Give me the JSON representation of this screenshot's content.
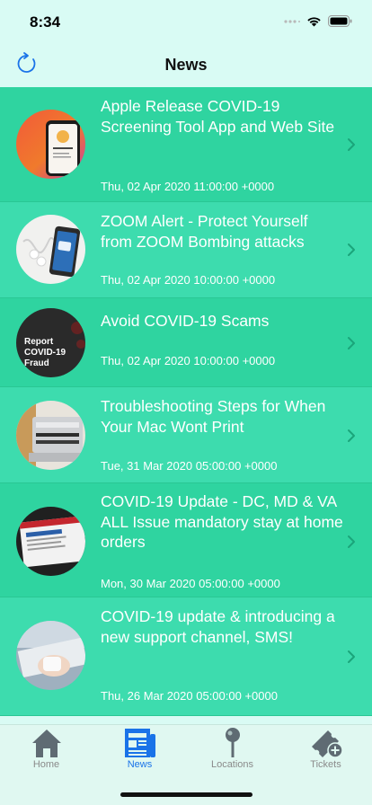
{
  "status_bar": {
    "time": "8:34"
  },
  "nav": {
    "title": "News"
  },
  "news": [
    {
      "title": "Apple Release COVID-19 Screening Tool App and Web Site",
      "date": "Thu, 02 Apr 2020 11:00:00 +0000",
      "thumb": "phone-screening-app"
    },
    {
      "title": "ZOOM Alert - Protect Yourself from ZOOM Bombing attacks",
      "date": "Thu, 02 Apr 2020 10:00:00 +0000",
      "thumb": "phone-earbuds"
    },
    {
      "title": "Avoid COVID-19 Scams",
      "date": "Thu, 02 Apr 2020 10:00:00 +0000",
      "thumb": "report-fraud",
      "thumb_text": [
        "Report",
        "COVID-19",
        "Fraud"
      ]
    },
    {
      "title": "Troubleshooting Steps for When Your Mac Wont Print",
      "date": "Tue, 31 Mar 2020 05:00:00 +0000",
      "thumb": "printer"
    },
    {
      "title": "COVID-19 Update - DC, MD & VA ALL Issue mandatory stay at home orders",
      "date": "Mon, 30 Mar 2020 05:00:00 +0000",
      "thumb": "laptop-news"
    },
    {
      "title": "COVID-19 update & introducing a new support channel, SMS!",
      "date": "Thu, 26 Mar 2020 05:00:00 +0000",
      "thumb": "hands-keyboard"
    }
  ],
  "tabs": [
    {
      "label": "Home",
      "icon": "house-icon",
      "active": false
    },
    {
      "label": "News",
      "icon": "newspaper-icon",
      "active": true
    },
    {
      "label": "Locations",
      "icon": "map-pin-icon",
      "active": false
    },
    {
      "label": "Tickets",
      "icon": "ticket-add-icon",
      "active": false
    }
  ],
  "colors": {
    "background": "#d9fbf4",
    "row": "#2fd4a0",
    "row_alt": "#3ddcae",
    "accent": "#1a73e8",
    "tab_inactive": "#8a8a8a"
  }
}
